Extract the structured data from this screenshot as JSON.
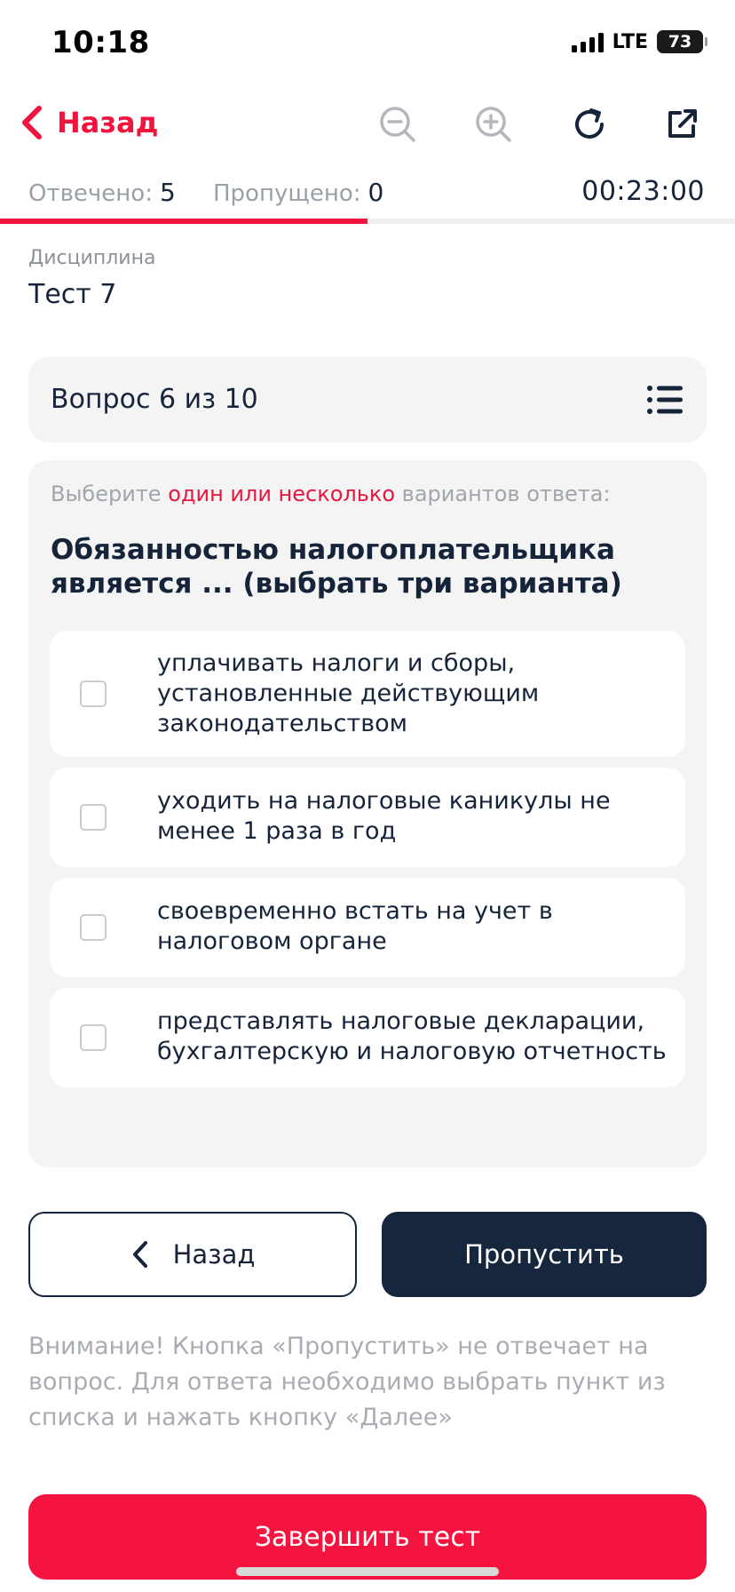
{
  "status_bar": {
    "time": "10:18",
    "network": "LTE",
    "battery": "73"
  },
  "nav": {
    "back_label": "Назад",
    "icons": [
      "zoom-out-icon",
      "zoom-in-icon",
      "refresh-icon",
      "external-link-icon"
    ],
    "accent_color": "#f0143f"
  },
  "progress": {
    "answered_label": "Отвечено:",
    "answered_value": "5",
    "skipped_label": "Пропущено:",
    "skipped_value": "0",
    "timer": "00:23:00",
    "fraction": 0.5
  },
  "discipline": {
    "label": "Дисциплина",
    "value": "Тест 7"
  },
  "question": {
    "counter": "Вопрос 6 из 10",
    "instruction_pre": "Выберите ",
    "instruction_accent": "один или несколько",
    "instruction_post": " вариантов ответа:",
    "text": "Обязанностью налогоплательщика является ... (выбрать три варианта)",
    "options": [
      {
        "text": "уплачивать налоги и сборы, установленные действующим законодательством",
        "checked": false
      },
      {
        "text": "уходить на налоговые каникулы не менее 1 раза в год",
        "checked": false
      },
      {
        "text": "своевременно встать на учет в налоговом органе",
        "checked": false
      },
      {
        "text": "представлять налоговые декларации, бухгалтерскую и налоговую отчетность",
        "checked": false
      }
    ]
  },
  "actions": {
    "back_label": "Назад",
    "skip_label": "Пропустить",
    "notice": "Внимание! Кнопка «Пропустить» не отвечает на вопрос. Для ответа необходимо выбрать пункт из списка и нажать кнопку «Далее»",
    "finish_label": "Завершить тест",
    "finish_color": "#f5133f",
    "dark_color": "#16263d"
  }
}
